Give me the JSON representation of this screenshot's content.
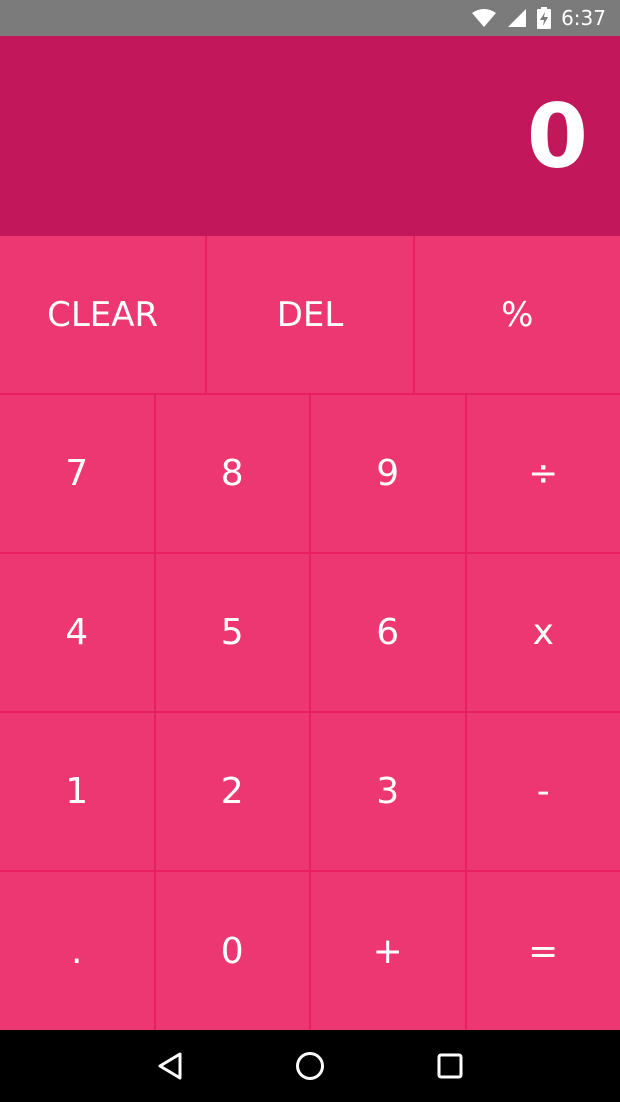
{
  "status_bar": {
    "time": "6:37"
  },
  "display": {
    "value": "0"
  },
  "keypad": {
    "row1": [
      "CLEAR",
      "DEL",
      "%"
    ],
    "row2": [
      "7",
      "8",
      "9",
      "÷"
    ],
    "row3": [
      "4",
      "5",
      "6",
      "x"
    ],
    "row4": [
      "1",
      "2",
      "3",
      "-"
    ],
    "row5": [
      ".",
      "0",
      "+",
      "="
    ]
  },
  "colors": {
    "display_bg": "#c2185b",
    "key_bg": "#ec3772",
    "key_border": "#e91e63",
    "status_bar_bg": "#7b7b7b"
  }
}
